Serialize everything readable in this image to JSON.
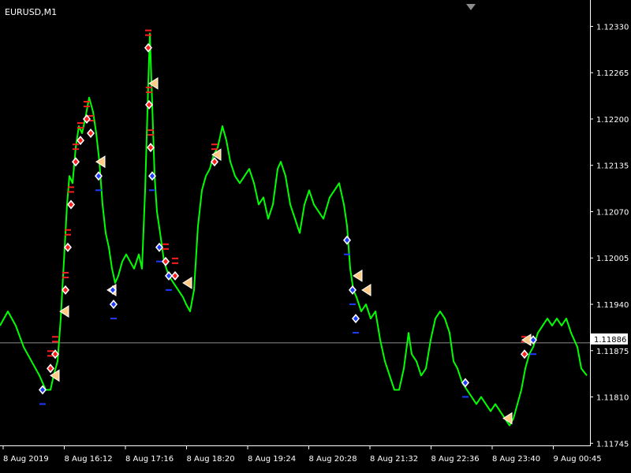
{
  "chart_data": {
    "type": "line",
    "title": "EURUSD,M1",
    "xlabel": "",
    "ylabel": "",
    "colors": {
      "background": "#000000",
      "axis": "#ffffff",
      "price_line": "#00ff00",
      "bid_line": "#8c8c8c",
      "sell_marker": "#ff1e1e",
      "buy_marker": "#1e3cff",
      "exit_marker": "#ffcc88"
    },
    "ylim": [
      1.11742,
      1.12367
    ],
    "y_ticks": [
      "1.12330",
      "1.12265",
      "1.12200",
      "1.12135",
      "1.12070",
      "1.12005",
      "1.11940",
      "1.11875",
      "1.11810",
      "1.11745"
    ],
    "x_ticks": [
      "8 Aug 2019",
      "8 Aug 16:12",
      "8 Aug 17:16",
      "8 Aug 18:20",
      "8 Aug 19:24",
      "8 Aug 20:28",
      "8 Aug 21:32",
      "8 Aug 22:36",
      "8 Aug 23:40",
      "9 Aug 00:45"
    ],
    "current_price": "1.11886",
    "price_series": [
      [
        0,
        1.1191
      ],
      [
        10,
        1.1193
      ],
      [
        20,
        1.1191
      ],
      [
        30,
        1.1188
      ],
      [
        40,
        1.1186
      ],
      [
        50,
        1.1184
      ],
      [
        58,
        1.1182
      ],
      [
        64,
        1.1182
      ],
      [
        68,
        1.1184
      ],
      [
        73,
        1.1186
      ],
      [
        77,
        1.1192
      ],
      [
        81,
        1.12
      ],
      [
        85,
        1.1208
      ],
      [
        88,
        1.1212
      ],
      [
        92,
        1.1211
      ],
      [
        96,
        1.1216
      ],
      [
        100,
        1.1219
      ],
      [
        104,
        1.1218
      ],
      [
        108,
        1.122
      ],
      [
        113,
        1.1223
      ],
      [
        118,
        1.1221
      ],
      [
        122,
        1.1218
      ],
      [
        126,
        1.1214
      ],
      [
        130,
        1.1208
      ],
      [
        134,
        1.1204
      ],
      [
        138,
        1.1202
      ],
      [
        142,
        1.1199
      ],
      [
        146,
        1.1197
      ],
      [
        150,
        1.1198
      ],
      [
        155,
        1.12
      ],
      [
        160,
        1.1201
      ],
      [
        165,
        1.12
      ],
      [
        170,
        1.1199
      ],
      [
        176,
        1.1201
      ],
      [
        180,
        1.1199
      ],
      [
        184,
        1.121
      ],
      [
        188,
        1.1225
      ],
      [
        190,
        1.1232
      ],
      [
        193,
        1.1222
      ],
      [
        196,
        1.1212
      ],
      [
        199,
        1.1207
      ],
      [
        203,
        1.1204
      ],
      [
        208,
        1.12
      ],
      [
        214,
        1.1198
      ],
      [
        220,
        1.1197
      ],
      [
        226,
        1.1196
      ],
      [
        232,
        1.1195
      ],
      [
        236,
        1.1194
      ],
      [
        241,
        1.1193
      ],
      [
        246,
        1.1196
      ],
      [
        251,
        1.1205
      ],
      [
        256,
        1.121
      ],
      [
        261,
        1.1212
      ],
      [
        266,
        1.1213
      ],
      [
        271,
        1.1215
      ],
      [
        276,
        1.1216
      ],
      [
        282,
        1.1219
      ],
      [
        287,
        1.1217
      ],
      [
        292,
        1.1214
      ],
      [
        298,
        1.1212
      ],
      [
        304,
        1.1211
      ],
      [
        310,
        1.1212
      ],
      [
        316,
        1.1213
      ],
      [
        322,
        1.1211
      ],
      [
        328,
        1.1208
      ],
      [
        334,
        1.1209
      ],
      [
        340,
        1.1206
      ],
      [
        346,
        1.1208
      ],
      [
        352,
        1.1213
      ],
      [
        356,
        1.1214
      ],
      [
        362,
        1.1212
      ],
      [
        368,
        1.1208
      ],
      [
        374,
        1.1206
      ],
      [
        380,
        1.1204
      ],
      [
        386,
        1.1208
      ],
      [
        392,
        1.121
      ],
      [
        398,
        1.1208
      ],
      [
        404,
        1.1207
      ],
      [
        410,
        1.1206
      ],
      [
        418,
        1.1209
      ],
      [
        424,
        1.121
      ],
      [
        430,
        1.1211
      ],
      [
        436,
        1.1208
      ],
      [
        440,
        1.1205
      ],
      [
        444,
        1.1199
      ],
      [
        448,
        1.1196
      ],
      [
        452,
        1.1195
      ],
      [
        458,
        1.1193
      ],
      [
        464,
        1.1194
      ],
      [
        470,
        1.1192
      ],
      [
        476,
        1.1193
      ],
      [
        482,
        1.1189
      ],
      [
        488,
        1.1186
      ],
      [
        494,
        1.1184
      ],
      [
        500,
        1.1182
      ],
      [
        506,
        1.1182
      ],
      [
        512,
        1.1185
      ],
      [
        518,
        1.119
      ],
      [
        522,
        1.1187
      ],
      [
        528,
        1.1186
      ],
      [
        534,
        1.1184
      ],
      [
        540,
        1.1185
      ],
      [
        546,
        1.1189
      ],
      [
        552,
        1.1192
      ],
      [
        558,
        1.1193
      ],
      [
        564,
        1.1192
      ],
      [
        570,
        1.119
      ],
      [
        575,
        1.1186
      ],
      [
        580,
        1.1185
      ],
      [
        586,
        1.1183
      ],
      [
        592,
        1.1182
      ],
      [
        598,
        1.1181
      ],
      [
        604,
        1.118
      ],
      [
        610,
        1.1181
      ],
      [
        616,
        1.118
      ],
      [
        622,
        1.1179
      ],
      [
        628,
        1.118
      ],
      [
        634,
        1.1179
      ],
      [
        640,
        1.1178
      ],
      [
        646,
        1.1177
      ],
      [
        651,
        1.1178
      ],
      [
        656,
        1.118
      ],
      [
        661,
        1.1182
      ],
      [
        666,
        1.1185
      ],
      [
        671,
        1.1187
      ],
      [
        676,
        1.1188
      ],
      [
        682,
        1.119
      ],
      [
        688,
        1.1191
      ],
      [
        694,
        1.1192
      ],
      [
        700,
        1.1191
      ],
      [
        706,
        1.1192
      ],
      [
        712,
        1.1191
      ],
      [
        718,
        1.1192
      ],
      [
        724,
        1.119
      ],
      [
        728,
        1.1189
      ],
      [
        732,
        1.1188
      ],
      [
        737,
        1.1185
      ],
      [
        744,
        1.1184
      ]
    ],
    "buy_signals": [
      [
        54,
        1.1182
      ],
      [
        125,
        1.1212
      ],
      [
        143,
        1.1196
      ],
      [
        144,
        1.1194
      ],
      [
        193,
        1.1212
      ],
      [
        202,
        1.1202
      ],
      [
        214,
        1.1198
      ],
      [
        440,
        1.1203
      ],
      [
        447,
        1.1196
      ],
      [
        451,
        1.1192
      ],
      [
        590,
        1.1183
      ],
      [
        676,
        1.1189
      ]
    ],
    "sell_signals": [
      [
        64,
        1.1185
      ],
      [
        70,
        1.1187
      ],
      [
        83,
        1.1196
      ],
      [
        86,
        1.1202
      ],
      [
        90,
        1.1208
      ],
      [
        96,
        1.1214
      ],
      [
        102,
        1.1217
      ],
      [
        110,
        1.122
      ],
      [
        115,
        1.1218
      ],
      [
        188,
        1.123
      ],
      [
        189,
        1.1222
      ],
      [
        191,
        1.1216
      ],
      [
        210,
        1.12
      ],
      [
        222,
        1.1198
      ],
      [
        272,
        1.1214
      ],
      [
        665,
        1.1187
      ]
    ],
    "exit_signals": [
      [
        70,
        1.1184
      ],
      [
        82,
        1.1193
      ],
      [
        128,
        1.1214
      ],
      [
        142,
        1.1196
      ],
      [
        195,
        1.1225
      ],
      [
        238,
        1.1197
      ],
      [
        275,
        1.1215
      ],
      [
        454,
        1.1198
      ],
      [
        465,
        1.1196
      ],
      [
        644,
        1.1178
      ],
      [
        668,
        1.1189
      ]
    ]
  }
}
